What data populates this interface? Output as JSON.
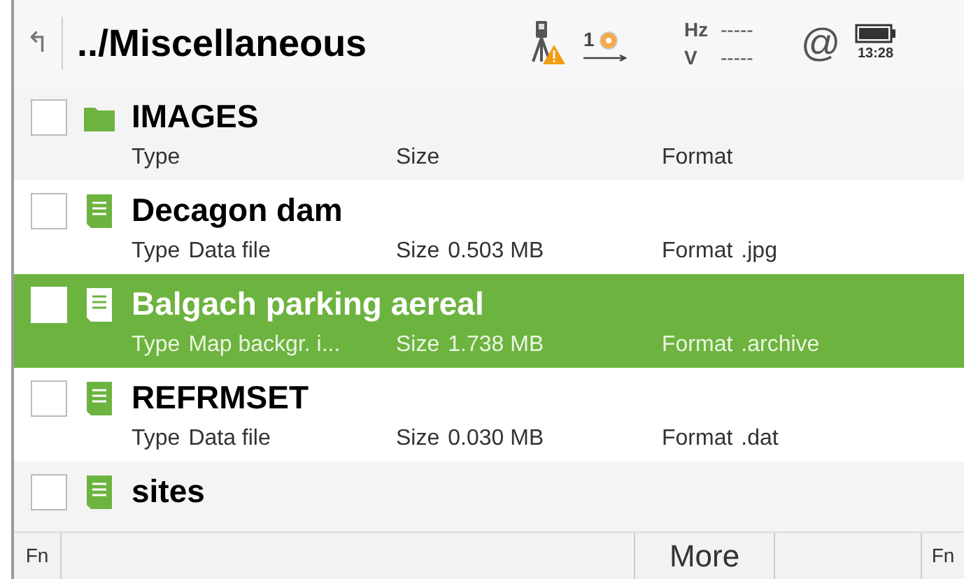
{
  "header": {
    "back": "↰",
    "title": "../Miscellaneous",
    "station": "1",
    "hz_label": "Hz",
    "hz_value": "-----",
    "v_label": "V",
    "v_value": "-----",
    "at": "@",
    "time": "13:28"
  },
  "files": [
    {
      "kind": "folder",
      "name": "IMAGES",
      "checked": false,
      "selected": false,
      "type_label": "Type",
      "size_label": "Size",
      "format_label": "Format"
    },
    {
      "kind": "file",
      "name": "Decagon dam",
      "checked": false,
      "selected": false,
      "type_label": "Type",
      "type": "Data file",
      "size_label": "Size",
      "size": "0.503 MB",
      "format_label": "Format",
      "format": ".jpg"
    },
    {
      "kind": "file",
      "name": "Balgach parking aereal",
      "checked": false,
      "selected": true,
      "type_label": "Type",
      "type": "Map backgr. i...",
      "size_label": "Size",
      "size": "1.738 MB",
      "format_label": "Format",
      "format": ".archive"
    },
    {
      "kind": "file",
      "name": "REFRMSET",
      "checked": false,
      "selected": false,
      "type_label": "Type",
      "type": "Data file",
      "size_label": "Size",
      "size": "0.030 MB",
      "format_label": "Format",
      "format": ".dat"
    },
    {
      "kind": "file",
      "name": "sites",
      "checked": false,
      "selected": false
    }
  ],
  "softkeys": {
    "left": "Fn",
    "middle": "More",
    "right": "Fn"
  }
}
